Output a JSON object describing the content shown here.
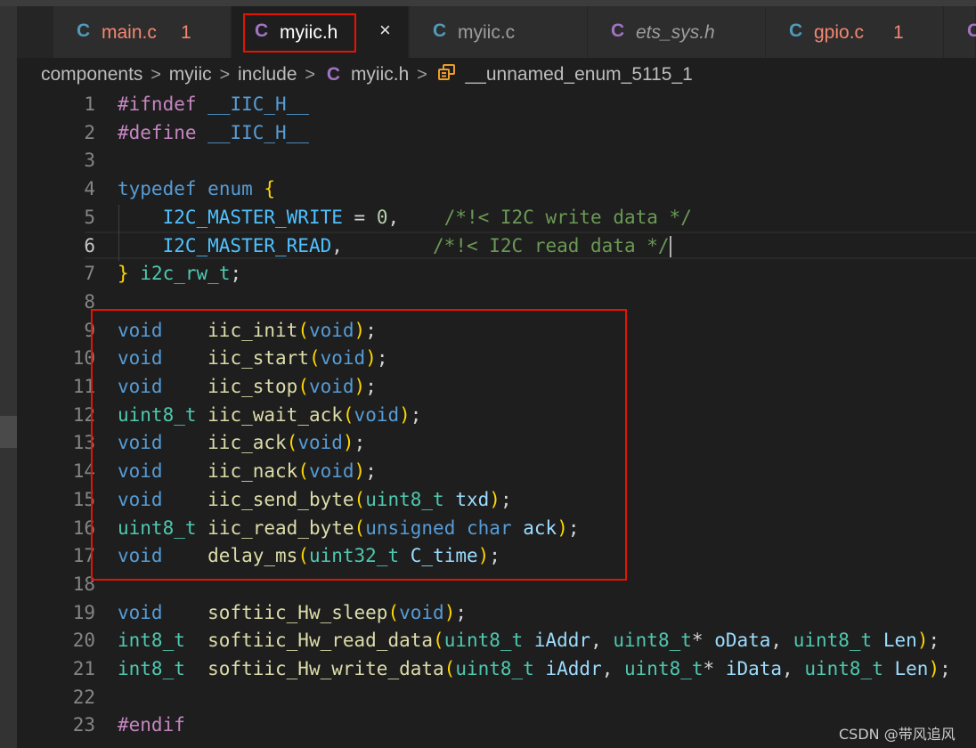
{
  "tabs": [
    {
      "label": "main.c",
      "icon": "C",
      "badge": "1",
      "color": "#f48771",
      "italic": false
    },
    {
      "label": "myiic.h",
      "icon": "C",
      "badge": "",
      "color": "#ffffff",
      "italic": false,
      "active": true,
      "close": "×"
    },
    {
      "label": "myiic.c",
      "icon": "C",
      "badge": "",
      "color": "#9d9d9d",
      "italic": false
    },
    {
      "label": "ets_sys.h",
      "icon": "C",
      "badge": "",
      "color": "#9d9d9d",
      "italic": true
    },
    {
      "label": "gpio.c",
      "icon": "C",
      "badge": "1",
      "color": "#f48771",
      "italic": false
    },
    {
      "label": "",
      "icon": "C",
      "badge": "",
      "color": "#9d9d9d",
      "italic": false
    }
  ],
  "breadcrumb": {
    "items": [
      "components",
      "myiic",
      "include"
    ],
    "file_icon": "C",
    "file": "myiic.h",
    "symbol": "__unnamed_enum_5115_1",
    "separator": ">"
  },
  "editor": {
    "current_line": 6,
    "lines": [
      {
        "n": "1",
        "tokens": [
          [
            "#ifndef",
            "pp"
          ],
          [
            " ",
            "id"
          ],
          [
            "__IIC_H__",
            "mac"
          ]
        ]
      },
      {
        "n": "2",
        "tokens": [
          [
            "#define",
            "pp"
          ],
          [
            " ",
            "id"
          ],
          [
            "__IIC_H__",
            "mac"
          ]
        ]
      },
      {
        "n": "3",
        "tokens": []
      },
      {
        "n": "4",
        "tokens": [
          [
            "typedef",
            "kw"
          ],
          [
            " ",
            "id"
          ],
          [
            "enum",
            "kw"
          ],
          [
            " ",
            "id"
          ],
          [
            "{",
            "p1"
          ]
        ]
      },
      {
        "n": "5",
        "tokens": [
          [
            "    ",
            "id"
          ],
          [
            "I2C_MASTER_WRITE",
            "en"
          ],
          [
            " = ",
            "id"
          ],
          [
            "0",
            "nu"
          ],
          [
            ",    ",
            "id"
          ],
          [
            "/*!< I2C write data */",
            "cm"
          ]
        ]
      },
      {
        "n": "6",
        "tokens": [
          [
            "    ",
            "id"
          ],
          [
            "I2C_MASTER_READ",
            "en"
          ],
          [
            ",        ",
            "id"
          ],
          [
            "/*!< I2C read data */",
            "cm"
          ]
        ],
        "caret": true
      },
      {
        "n": "7",
        "tokens": [
          [
            "}",
            "p1"
          ],
          [
            " ",
            "id"
          ],
          [
            "i2c_rw_t",
            "ty"
          ],
          [
            ";",
            "id"
          ]
        ]
      },
      {
        "n": "8",
        "tokens": []
      },
      {
        "n": "9",
        "tokens": [
          [
            "void",
            "kw"
          ],
          [
            "    ",
            "id"
          ],
          [
            "iic_init",
            "fn"
          ],
          [
            "(",
            "p1"
          ],
          [
            "void",
            "kw"
          ],
          [
            ")",
            "p1"
          ],
          [
            ";",
            "id"
          ]
        ]
      },
      {
        "n": "10",
        "tokens": [
          [
            "void",
            "kw"
          ],
          [
            "    ",
            "id"
          ],
          [
            "iic_start",
            "fn"
          ],
          [
            "(",
            "p1"
          ],
          [
            "void",
            "kw"
          ],
          [
            ")",
            "p1"
          ],
          [
            ";",
            "id"
          ]
        ]
      },
      {
        "n": "11",
        "tokens": [
          [
            "void",
            "kw"
          ],
          [
            "    ",
            "id"
          ],
          [
            "iic_stop",
            "fn"
          ],
          [
            "(",
            "p1"
          ],
          [
            "void",
            "kw"
          ],
          [
            ")",
            "p1"
          ],
          [
            ";",
            "id"
          ]
        ]
      },
      {
        "n": "12",
        "tokens": [
          [
            "uint8_t",
            "ty"
          ],
          [
            " ",
            "id"
          ],
          [
            "iic_wait_ack",
            "fn"
          ],
          [
            "(",
            "p1"
          ],
          [
            "void",
            "kw"
          ],
          [
            ")",
            "p1"
          ],
          [
            ";",
            "id"
          ]
        ]
      },
      {
        "n": "13",
        "tokens": [
          [
            "void",
            "kw"
          ],
          [
            "    ",
            "id"
          ],
          [
            "iic_ack",
            "fn"
          ],
          [
            "(",
            "p1"
          ],
          [
            "void",
            "kw"
          ],
          [
            ")",
            "p1"
          ],
          [
            ";",
            "id"
          ]
        ]
      },
      {
        "n": "14",
        "tokens": [
          [
            "void",
            "kw"
          ],
          [
            "    ",
            "id"
          ],
          [
            "iic_nack",
            "fn"
          ],
          [
            "(",
            "p1"
          ],
          [
            "void",
            "kw"
          ],
          [
            ")",
            "p1"
          ],
          [
            ";",
            "id"
          ]
        ]
      },
      {
        "n": "15",
        "tokens": [
          [
            "void",
            "kw"
          ],
          [
            "    ",
            "id"
          ],
          [
            "iic_send_byte",
            "fn"
          ],
          [
            "(",
            "p1"
          ],
          [
            "uint8_t",
            "ty"
          ],
          [
            " ",
            "id"
          ],
          [
            "txd",
            "pa"
          ],
          [
            ")",
            "p1"
          ],
          [
            ";",
            "id"
          ]
        ]
      },
      {
        "n": "16",
        "tokens": [
          [
            "uint8_t",
            "ty"
          ],
          [
            " ",
            "id"
          ],
          [
            "iic_read_byte",
            "fn"
          ],
          [
            "(",
            "p1"
          ],
          [
            "unsigned",
            "kw"
          ],
          [
            " ",
            "id"
          ],
          [
            "char",
            "kw"
          ],
          [
            " ",
            "id"
          ],
          [
            "ack",
            "pa"
          ],
          [
            ")",
            "p1"
          ],
          [
            ";",
            "id"
          ]
        ]
      },
      {
        "n": "17",
        "tokens": [
          [
            "void",
            "kw"
          ],
          [
            "    ",
            "id"
          ],
          [
            "delay_ms",
            "fn"
          ],
          [
            "(",
            "p1"
          ],
          [
            "uint32_t",
            "ty"
          ],
          [
            " ",
            "id"
          ],
          [
            "C_time",
            "pa"
          ],
          [
            ")",
            "p1"
          ],
          [
            ";",
            "id"
          ]
        ]
      },
      {
        "n": "18",
        "tokens": []
      },
      {
        "n": "19",
        "tokens": [
          [
            "void",
            "kw"
          ],
          [
            "    ",
            "id"
          ],
          [
            "softiic_Hw_sleep",
            "fn"
          ],
          [
            "(",
            "p1"
          ],
          [
            "void",
            "kw"
          ],
          [
            ")",
            "p1"
          ],
          [
            ";",
            "id"
          ]
        ]
      },
      {
        "n": "20",
        "tokens": [
          [
            "int8_t",
            "ty"
          ],
          [
            "  ",
            "id"
          ],
          [
            "softiic_Hw_read_data",
            "fn"
          ],
          [
            "(",
            "p1"
          ],
          [
            "uint8_t",
            "ty"
          ],
          [
            " ",
            "id"
          ],
          [
            "iAddr",
            "pa"
          ],
          [
            ", ",
            "id"
          ],
          [
            "uint8_t",
            "ty"
          ],
          [
            "* ",
            "id"
          ],
          [
            "oData",
            "pa"
          ],
          [
            ", ",
            "id"
          ],
          [
            "uint8_t",
            "ty"
          ],
          [
            " ",
            "id"
          ],
          [
            "Len",
            "pa"
          ],
          [
            ")",
            "p1"
          ],
          [
            ";",
            "id"
          ]
        ]
      },
      {
        "n": "21",
        "tokens": [
          [
            "int8_t",
            "ty"
          ],
          [
            "  ",
            "id"
          ],
          [
            "softiic_Hw_write_data",
            "fn"
          ],
          [
            "(",
            "p1"
          ],
          [
            "uint8_t",
            "ty"
          ],
          [
            " ",
            "id"
          ],
          [
            "iAddr",
            "pa"
          ],
          [
            ", ",
            "id"
          ],
          [
            "uint8_t",
            "ty"
          ],
          [
            "* ",
            "id"
          ],
          [
            "iData",
            "pa"
          ],
          [
            ", ",
            "id"
          ],
          [
            "uint8_t",
            "ty"
          ],
          [
            " ",
            "id"
          ],
          [
            "Len",
            "pa"
          ],
          [
            ")",
            "p1"
          ],
          [
            ";",
            "id"
          ]
        ]
      },
      {
        "n": "22",
        "tokens": []
      },
      {
        "n": "23",
        "tokens": [
          [
            "#endif",
            "pp"
          ]
        ]
      }
    ]
  },
  "watermark": "CSDN @带风追风",
  "colors": {
    "accent_red": "#e51400",
    "c_icon": "#519aba",
    "h_icon": "#a074c4"
  }
}
